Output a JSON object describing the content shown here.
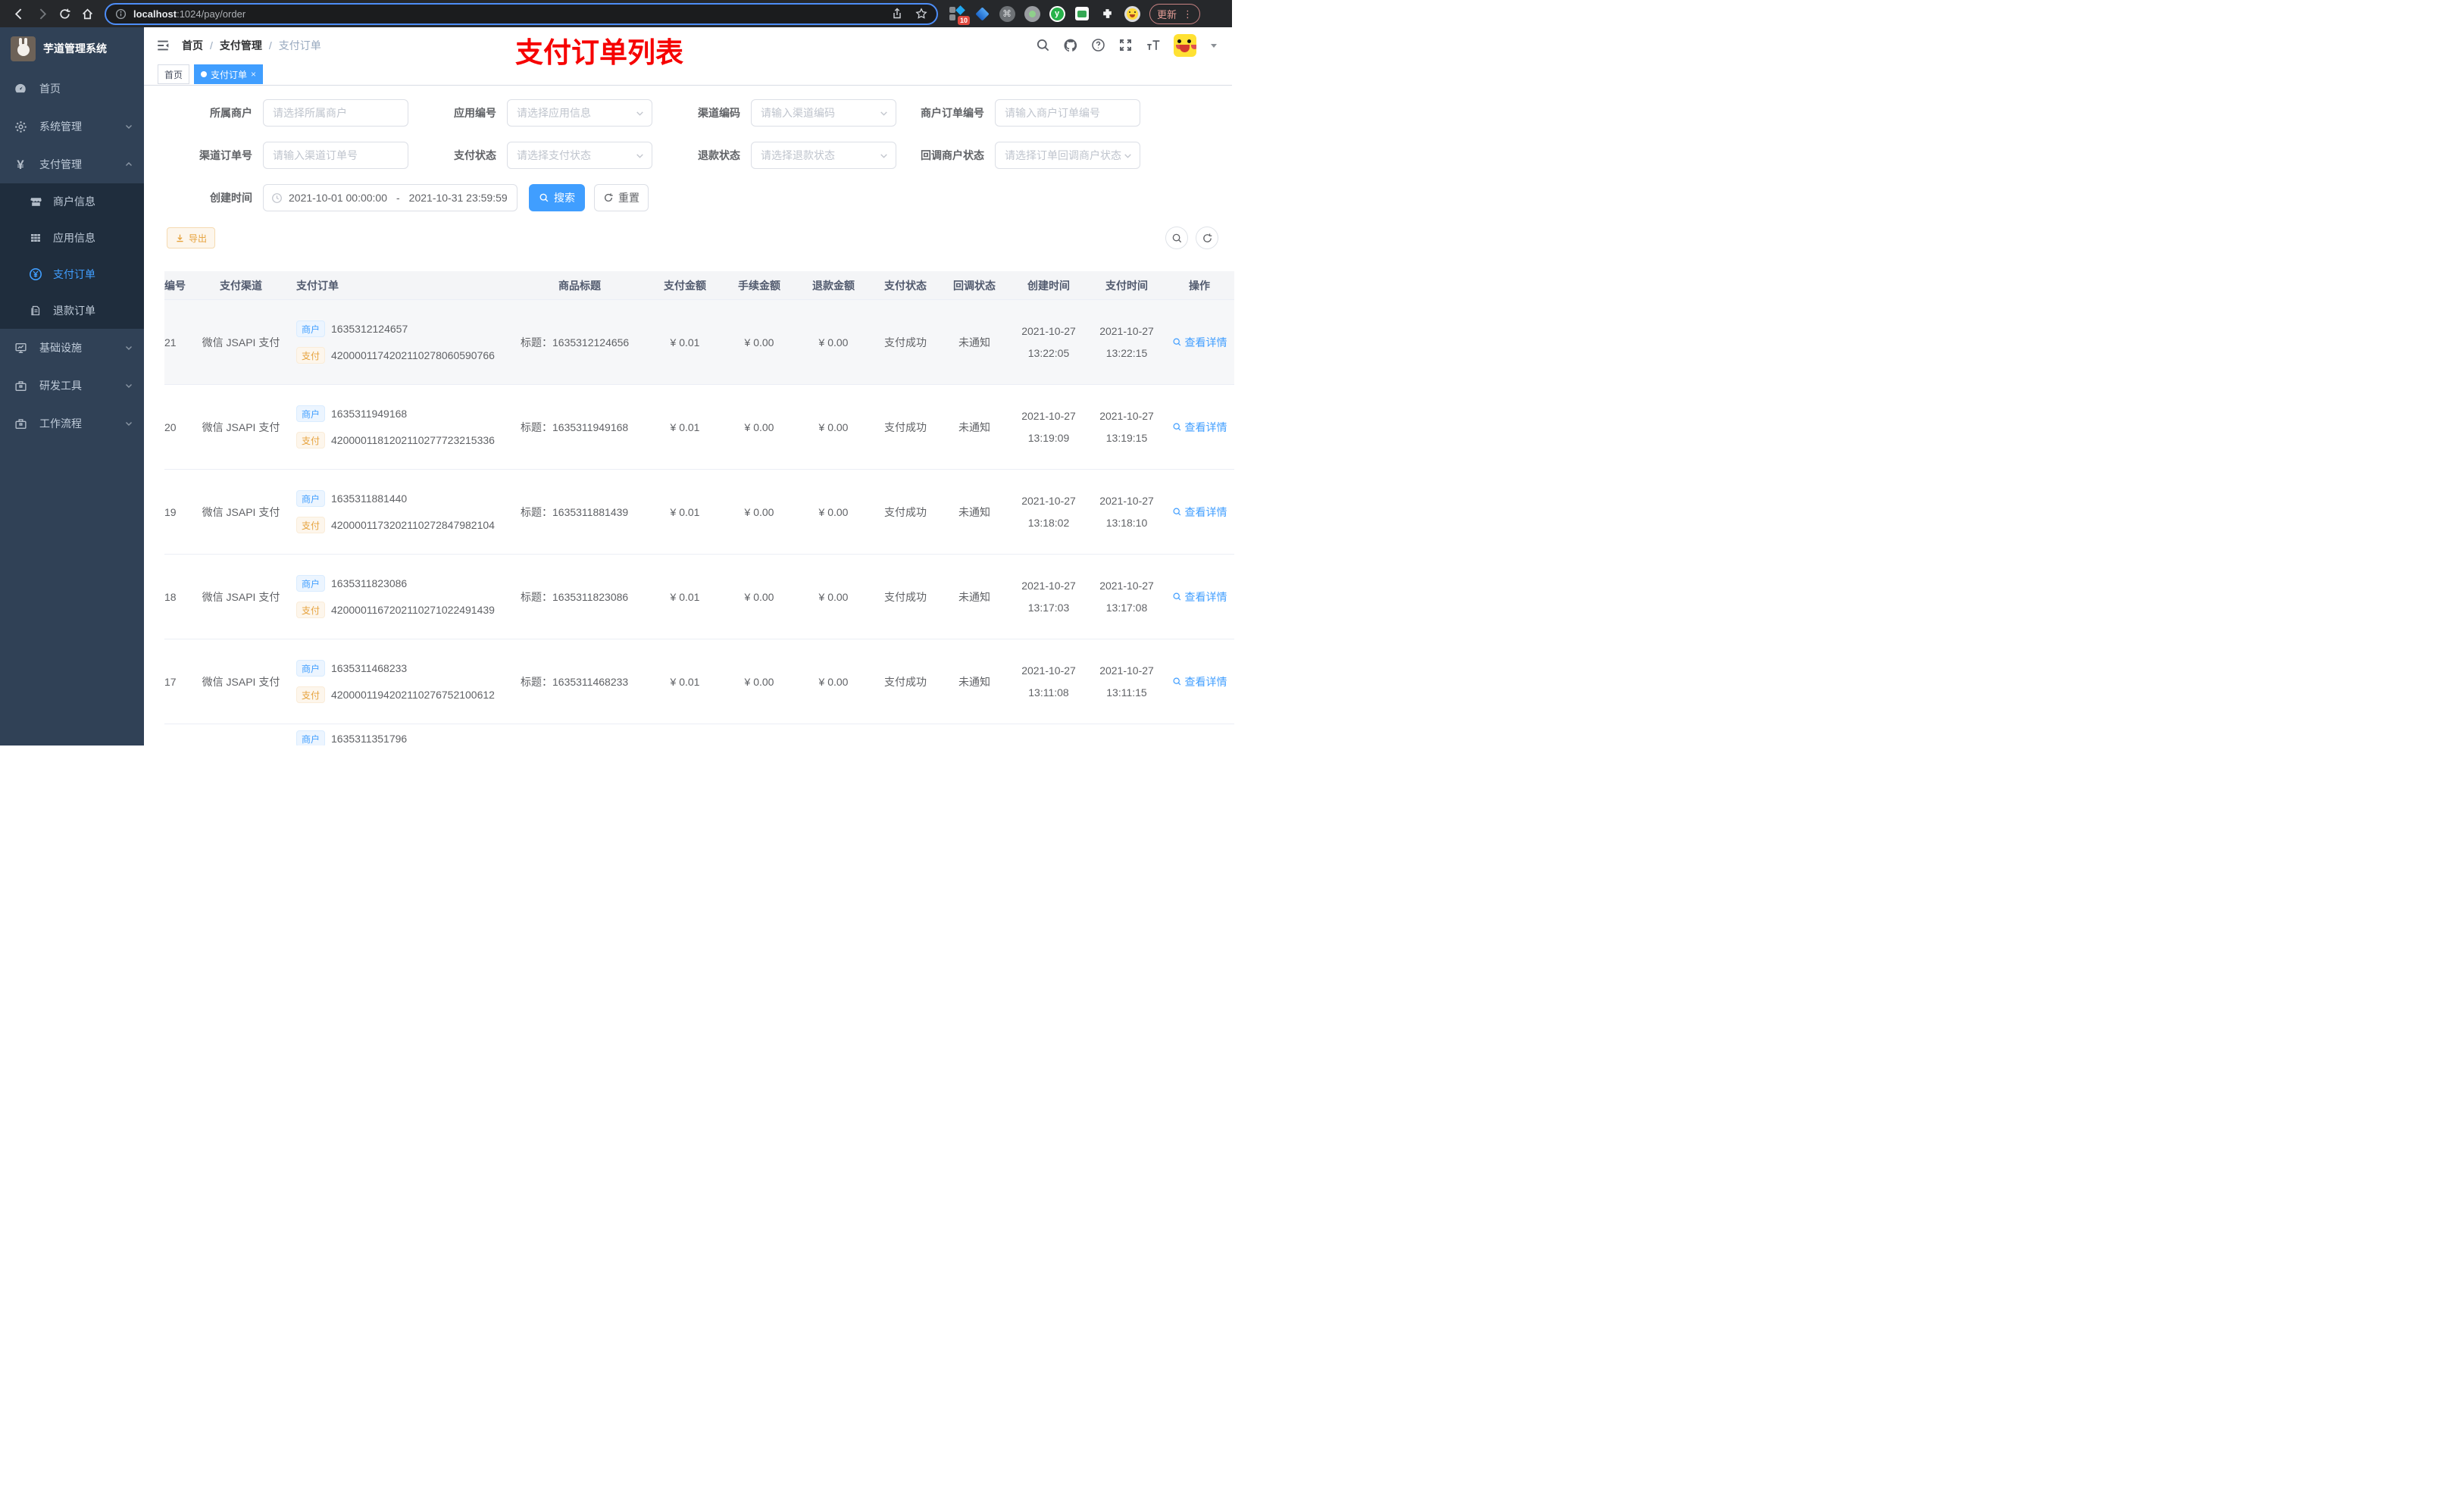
{
  "browser": {
    "url_host": "localhost",
    "url_path": ":1024/pay/order",
    "badge_count": "10",
    "update_label": "更新"
  },
  "sidebar": {
    "app_title": "芋道管理系统",
    "items": [
      {
        "label": "首页"
      },
      {
        "label": "系统管理"
      },
      {
        "label": "支付管理"
      },
      {
        "label": "商户信息"
      },
      {
        "label": "应用信息"
      },
      {
        "label": "支付订单"
      },
      {
        "label": "退款订单"
      },
      {
        "label": "基础设施"
      },
      {
        "label": "研发工具"
      },
      {
        "label": "工作流程"
      }
    ]
  },
  "navbar": {
    "breadcrumb": [
      "首页",
      "支付管理",
      "支付订单"
    ],
    "breadcrumb_sep": "/",
    "annotation": "支付订单列表"
  },
  "tags": {
    "items": [
      {
        "label": "首页"
      },
      {
        "label": "支付订单"
      }
    ]
  },
  "filters": {
    "fields": [
      {
        "label": "所属商户",
        "placeholder": "请选择所属商户"
      },
      {
        "label": "应用编号",
        "placeholder": "请选择应用信息"
      },
      {
        "label": "渠道编码",
        "placeholder": "请输入渠道编码"
      },
      {
        "label": "商户订单编号",
        "placeholder": "请输入商户订单编号"
      },
      {
        "label": "渠道订单号",
        "placeholder": "请输入渠道订单号"
      },
      {
        "label": "支付状态",
        "placeholder": "请选择支付状态"
      },
      {
        "label": "退款状态",
        "placeholder": "请选择退款状态"
      },
      {
        "label": "回调商户状态",
        "placeholder": "请选择订单回调商户状态"
      }
    ],
    "date_label": "创建时间",
    "date_start": "2021-10-01 00:00:00",
    "date_range_sep": "-",
    "date_end": "2021-10-31 23:59:59",
    "search_label": "搜索",
    "reset_label": "重置"
  },
  "toolbar": {
    "export_label": "导出"
  },
  "table": {
    "columns": [
      "编号",
      "支付渠道",
      "支付订单",
      "商品标题",
      "支付金额",
      "手续金额",
      "退款金额",
      "支付状态",
      "回调状态",
      "创建时间",
      "支付时间",
      "操作"
    ],
    "tag_merchant": "商户",
    "tag_pay": "支付",
    "action_label": "查看详情",
    "rows": [
      {
        "id": "21",
        "channel": "微信 JSAPI 支付",
        "merchant_no": "1635312124657",
        "pay_no": "4200001174202110278060590766",
        "title": "标题：1635312124656",
        "amount": "¥ 0.01",
        "fee": "¥ 0.00",
        "refund": "¥ 0.00",
        "pay_status": "支付成功",
        "notify_status": "未通知",
        "created_date": "2021-10-27",
        "created_time": "13:22:05",
        "paid_date": "2021-10-27",
        "paid_time": "13:22:15"
      },
      {
        "id": "20",
        "channel": "微信 JSAPI 支付",
        "merchant_no": "1635311949168",
        "pay_no": "4200001181202110277723215336",
        "title": "标题：1635311949168",
        "amount": "¥ 0.01",
        "fee": "¥ 0.00",
        "refund": "¥ 0.00",
        "pay_status": "支付成功",
        "notify_status": "未通知",
        "created_date": "2021-10-27",
        "created_time": "13:19:09",
        "paid_date": "2021-10-27",
        "paid_time": "13:19:15"
      },
      {
        "id": "19",
        "channel": "微信 JSAPI 支付",
        "merchant_no": "1635311881440",
        "pay_no": "4200001173202110272847982104",
        "title": "标题：1635311881439",
        "amount": "¥ 0.01",
        "fee": "¥ 0.00",
        "refund": "¥ 0.00",
        "pay_status": "支付成功",
        "notify_status": "未通知",
        "created_date": "2021-10-27",
        "created_time": "13:18:02",
        "paid_date": "2021-10-27",
        "paid_time": "13:18:10"
      },
      {
        "id": "18",
        "channel": "微信 JSAPI 支付",
        "merchant_no": "1635311823086",
        "pay_no": "4200001167202110271022491439",
        "title": "标题：1635311823086",
        "amount": "¥ 0.01",
        "fee": "¥ 0.00",
        "refund": "¥ 0.00",
        "pay_status": "支付成功",
        "notify_status": "未通知",
        "created_date": "2021-10-27",
        "created_time": "13:17:03",
        "paid_date": "2021-10-27",
        "paid_time": "13:17:08"
      },
      {
        "id": "17",
        "channel": "微信 JSAPI 支付",
        "merchant_no": "1635311468233",
        "pay_no": "4200001194202110276752100612",
        "title": "标题：1635311468233",
        "amount": "¥ 0.01",
        "fee": "¥ 0.00",
        "refund": "¥ 0.00",
        "pay_status": "支付成功",
        "notify_status": "未通知",
        "created_date": "2021-10-27",
        "created_time": "13:11:08",
        "paid_date": "2021-10-27",
        "paid_time": "13:11:15"
      }
    ],
    "partial_row": {
      "merchant_no": "1635311351796"
    }
  },
  "colors": {
    "accent": "#409eff",
    "annotation_red": "#f60000",
    "sidebar_bg": "#304156",
    "submenu_bg": "#1f2d3d",
    "warning": "#e6a23c"
  }
}
